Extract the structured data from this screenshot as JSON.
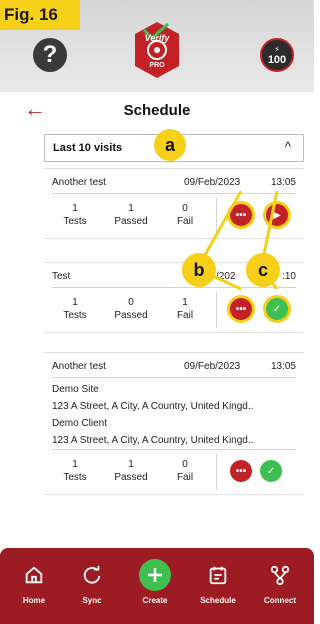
{
  "figure_label": "Fig. 16",
  "header": {
    "help_icon_text": "?",
    "logo_text": "Verify",
    "logo_sub": "PRO",
    "score": "100",
    "bolt": "⚡"
  },
  "page": {
    "back_glyph": "←",
    "title": "Schedule"
  },
  "filter": {
    "selected": "Last 10 visits",
    "chevron": "^"
  },
  "annotations": {
    "a": "a",
    "b": "b",
    "c": "c"
  },
  "stat_labels": {
    "tests": "Tests",
    "passed": "Passed",
    "fail": "Fail"
  },
  "cards": [
    {
      "name": "Another test",
      "date": "09/Feb/2023",
      "time": "13:05",
      "tests": "1",
      "passed": "1",
      "fail": "0",
      "actions": [
        "more",
        "play"
      ]
    },
    {
      "name": "Test",
      "date": "/202",
      "time": ":10",
      "tests": "1",
      "passed": "0",
      "fail": "1",
      "actions": [
        "more",
        "check"
      ]
    },
    {
      "name": "Another test",
      "date": "09/Feb/2023",
      "time": "13:05",
      "site_name": "Demo Site",
      "site_address": "123 A Street, A City, A Country, United Kingd..",
      "client_name": "Demo Client",
      "client_address": "123 A Street, A City, A Country, United Kingd..",
      "tests": "1",
      "passed": "1",
      "fail": "0",
      "actions": [
        "more",
        "check"
      ]
    }
  ],
  "action_glyphs": {
    "more": "•••",
    "play": "▶",
    "check": "✓"
  },
  "bottom_nav": [
    {
      "label": "Home",
      "icon": "home-icon"
    },
    {
      "label": "Sync",
      "icon": "sync-icon"
    },
    {
      "label": "Create",
      "icon": "plus-icon"
    },
    {
      "label": "Schedule",
      "icon": "calendar-icon"
    },
    {
      "label": "Connect",
      "icon": "connect-icon"
    }
  ],
  "colors": {
    "brand_red": "#c42126",
    "nav_red": "#9d1b22",
    "accent_green": "#3fbf52",
    "annotation_yellow": "#f5cf18"
  }
}
